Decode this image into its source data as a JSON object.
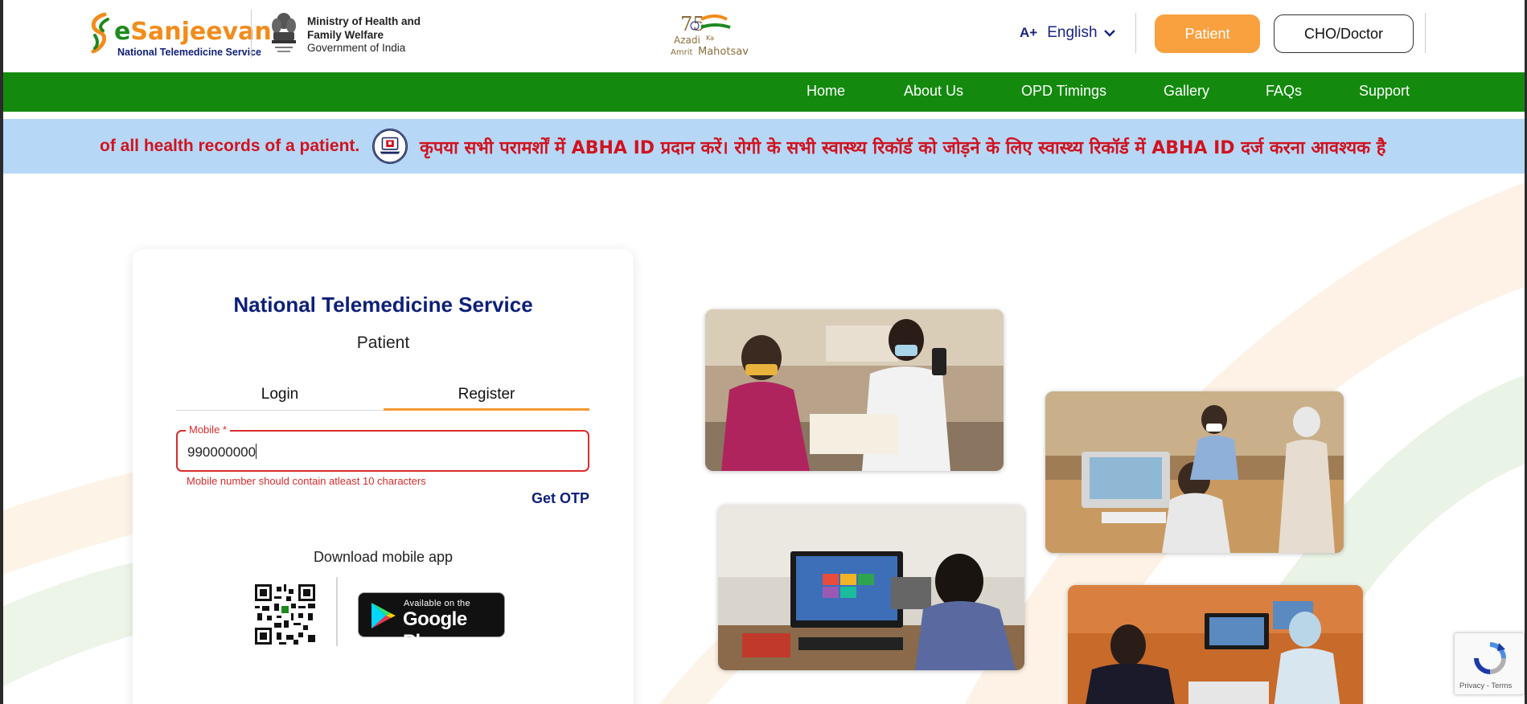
{
  "header": {
    "logo_name_e": "e",
    "logo_name_rest": "Sanjeevani",
    "logo_subtitle": "National Telemedicine Service",
    "ministry_line1": "Ministry of Health and",
    "ministry_line2": "Family Welfare",
    "ministry_line3": "Government of India",
    "azadi_text": "Azadi Ka Amrit Mahotsav",
    "font_size_label": "A+",
    "language": "English",
    "patient_button": "Patient",
    "doctor_button": "CHO/Doctor"
  },
  "nav": {
    "items": [
      {
        "label": "Home"
      },
      {
        "label": "About Us"
      },
      {
        "label": "OPD Timings"
      },
      {
        "label": "Gallery"
      },
      {
        "label": "FAQs"
      },
      {
        "label": "Support"
      }
    ]
  },
  "ticker": {
    "english_fragment": "of all health records of a patient.",
    "hindi_text": "कृपया सभी परामर्शों में ABHA ID प्रदान करें। रोगी के सभी स्वास्थ्य रिकॉर्ड को जोड़ने के लिए स्वास्थ्य रिकॉर्ड में ABHA ID दर्ज करना आवश्यक है"
  },
  "card": {
    "title": "National Telemedicine Service",
    "subtitle": "Patient",
    "tabs": [
      {
        "label": "Login"
      },
      {
        "label": "Register"
      }
    ],
    "active_tab": "Register",
    "mobile_field": {
      "label": "Mobile *",
      "value": "990000000",
      "error": "Mobile number should contain atleast 10 characters"
    },
    "get_otp": "Get OTP",
    "download_label": "Download mobile app",
    "store_small": "Available on the",
    "store_big": "Google Play"
  },
  "recaptcha": {
    "footer": "Privacy - Terms"
  },
  "colors": {
    "nav_green": "#138a0e",
    "ticker_blue": "#b6d8f6",
    "ticker_red": "#d0131f",
    "patient_orange": "#f9a03f",
    "title_navy": "#0d1f7a",
    "error_red": "#d92c2c"
  }
}
